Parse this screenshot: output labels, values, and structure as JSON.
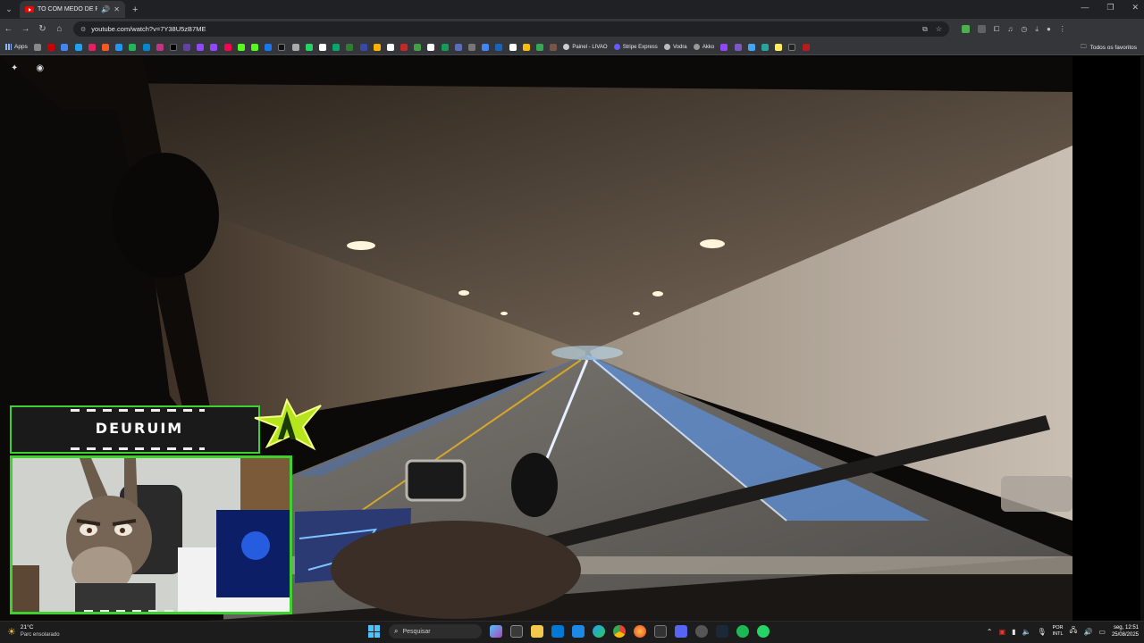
{
  "browser": {
    "tab": {
      "title": "TO COM MEDO DE PERDER..."
    },
    "url": "youtube.com/watch?v=7Y38U5zB7ME",
    "bookmarks": {
      "apps_label": "Apps",
      "named": [
        "Painel - LIVAO",
        "Stripe Express",
        "Vodra",
        "Akko"
      ],
      "all_label": "Todos os favoritos"
    }
  },
  "overlay": {
    "streamer_name": "DEURUIM"
  },
  "taskbar": {
    "weather": {
      "temp": "21°C",
      "desc": "Parc ensolarado"
    },
    "search_placeholder": "Pesquisar",
    "lang": {
      "line1": "POR",
      "line2": "INTL"
    },
    "clock": {
      "time": "seg, 12:51",
      "date": "25/08/2025"
    }
  }
}
